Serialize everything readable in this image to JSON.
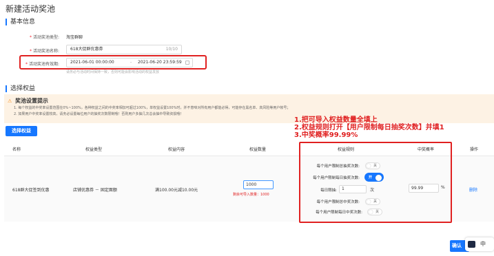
{
  "page": {
    "title": "新建活动奖池"
  },
  "basic_info": {
    "section_title": "基本信息",
    "type_label": "活动奖池类型:",
    "type_value": "淘宝群聊",
    "name_label": "活动奖池名称:",
    "name_value": "618大促群优惠券",
    "name_count": "10/10",
    "time_label": "活动奖池有效期:",
    "time_start": "2021-06-01 00:00:00",
    "time_sep": "-",
    "time_end": "2021-06-20 23:59:59",
    "time_hint": "请务必与活动时间保持一致，否则可能会影响活动的权益发放"
  },
  "rights": {
    "section_title": "选择权益",
    "warning_title": "奖池设置提示",
    "warning_line1": "1. 每个权益的中奖率设置范围在0%~100%，各种权益之间的中奖率相加可超过100%，单权益设置100%时，并不意味对所有用户都能必得，可能存在黑名单、高风险等用户帐号；",
    "warning_line2": "2. 如果用户中奖率设置较高，请务必设置每位用户的抽奖次数限制哦！否则用户多抽几次总会抽中导致资损哦！",
    "select_button": "选择权益"
  },
  "annotation": {
    "line1": "1.把可导入权益数量全填上",
    "line2": "2.权益规则打开【用户限制每日抽奖次数】并填1",
    "line3": "3.中奖概率99.99%"
  },
  "table": {
    "headers": [
      "名称",
      "权益类型",
      "权益内容",
      "权益数量",
      "权益规则",
      "中奖概率",
      "操作"
    ],
    "row": {
      "name": "618群大促签到优惠",
      "type": "店铺优惠券 － 固定面额",
      "content": "满100.00元减10.00元",
      "quantity": "1000",
      "remaining": "剩余可导入数量：1000",
      "rules": {
        "total_limit_label": "每个用户限制总抽奖次数:",
        "total_limit_state": "关",
        "daily_limit_label": "每个用户限制每日抽奖次数:",
        "daily_limit_state": "开",
        "daily_count_label": "每日限抽:",
        "daily_count_value": "1",
        "daily_count_unit": "次",
        "total_win_label": "每个用户限制总中奖次数:",
        "total_win_state": "关",
        "daily_win_label": "每个用户限制每日中奖次数:",
        "daily_win_state": "关"
      },
      "probability": "99.99",
      "probability_unit": "%",
      "action": "删除"
    }
  },
  "footer": {
    "confirm_button": "确认",
    "float_widget_text": "中"
  },
  "colors": {
    "primary": "#1677ff",
    "annotation_red": "#e02020",
    "warning_bg": "#fdf2e4"
  }
}
